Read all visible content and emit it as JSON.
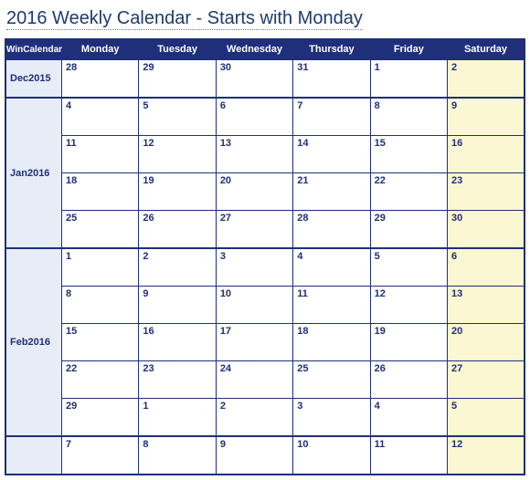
{
  "title": "2016 Weekly Calendar - Starts with Monday",
  "corner": "WinCalendar",
  "days": [
    "Monday",
    "Tuesday",
    "Wednesday",
    "Thursday",
    "Friday",
    "Saturday"
  ],
  "months": [
    {
      "label": "Dec2015",
      "rows": [
        [
          {
            "n": "28"
          },
          {
            "n": "29"
          },
          {
            "n": "30"
          },
          {
            "n": "31"
          },
          {
            "n": "1"
          },
          {
            "n": "2",
            "sat": true
          }
        ]
      ]
    },
    {
      "label": "Jan2016",
      "rows": [
        [
          {
            "n": "4"
          },
          {
            "n": "5"
          },
          {
            "n": "6"
          },
          {
            "n": "7"
          },
          {
            "n": "8"
          },
          {
            "n": "9",
            "sat": true
          }
        ],
        [
          {
            "n": "11"
          },
          {
            "n": "12"
          },
          {
            "n": "13"
          },
          {
            "n": "14"
          },
          {
            "n": "15"
          },
          {
            "n": "16",
            "sat": true
          }
        ],
        [
          {
            "n": "18"
          },
          {
            "n": "19"
          },
          {
            "n": "20"
          },
          {
            "n": "21"
          },
          {
            "n": "22"
          },
          {
            "n": "23",
            "sat": true
          }
        ],
        [
          {
            "n": "25"
          },
          {
            "n": "26"
          },
          {
            "n": "27"
          },
          {
            "n": "28"
          },
          {
            "n": "29"
          },
          {
            "n": "30",
            "sat": true
          }
        ]
      ]
    },
    {
      "label": "Feb2016",
      "rows": [
        [
          {
            "n": "1"
          },
          {
            "n": "2"
          },
          {
            "n": "3"
          },
          {
            "n": "4"
          },
          {
            "n": "5"
          },
          {
            "n": "6",
            "sat": true
          }
        ],
        [
          {
            "n": "8"
          },
          {
            "n": "9"
          },
          {
            "n": "10"
          },
          {
            "n": "11"
          },
          {
            "n": "12"
          },
          {
            "n": "13",
            "sat": true
          }
        ],
        [
          {
            "n": "15"
          },
          {
            "n": "16"
          },
          {
            "n": "17"
          },
          {
            "n": "18"
          },
          {
            "n": "19"
          },
          {
            "n": "20",
            "sat": true
          }
        ],
        [
          {
            "n": "22"
          },
          {
            "n": "23"
          },
          {
            "n": "24"
          },
          {
            "n": "25"
          },
          {
            "n": "26"
          },
          {
            "n": "27",
            "sat": true
          }
        ],
        [
          {
            "n": "29"
          },
          {
            "n": "1"
          },
          {
            "n": "2"
          },
          {
            "n": "3"
          },
          {
            "n": "4"
          },
          {
            "n": "5",
            "sat": true
          }
        ]
      ]
    },
    {
      "label": "",
      "rows": [
        [
          {
            "n": "7"
          },
          {
            "n": "8"
          },
          {
            "n": "9"
          },
          {
            "n": "10"
          },
          {
            "n": "11"
          },
          {
            "n": "12",
            "sat": true
          }
        ]
      ]
    }
  ]
}
